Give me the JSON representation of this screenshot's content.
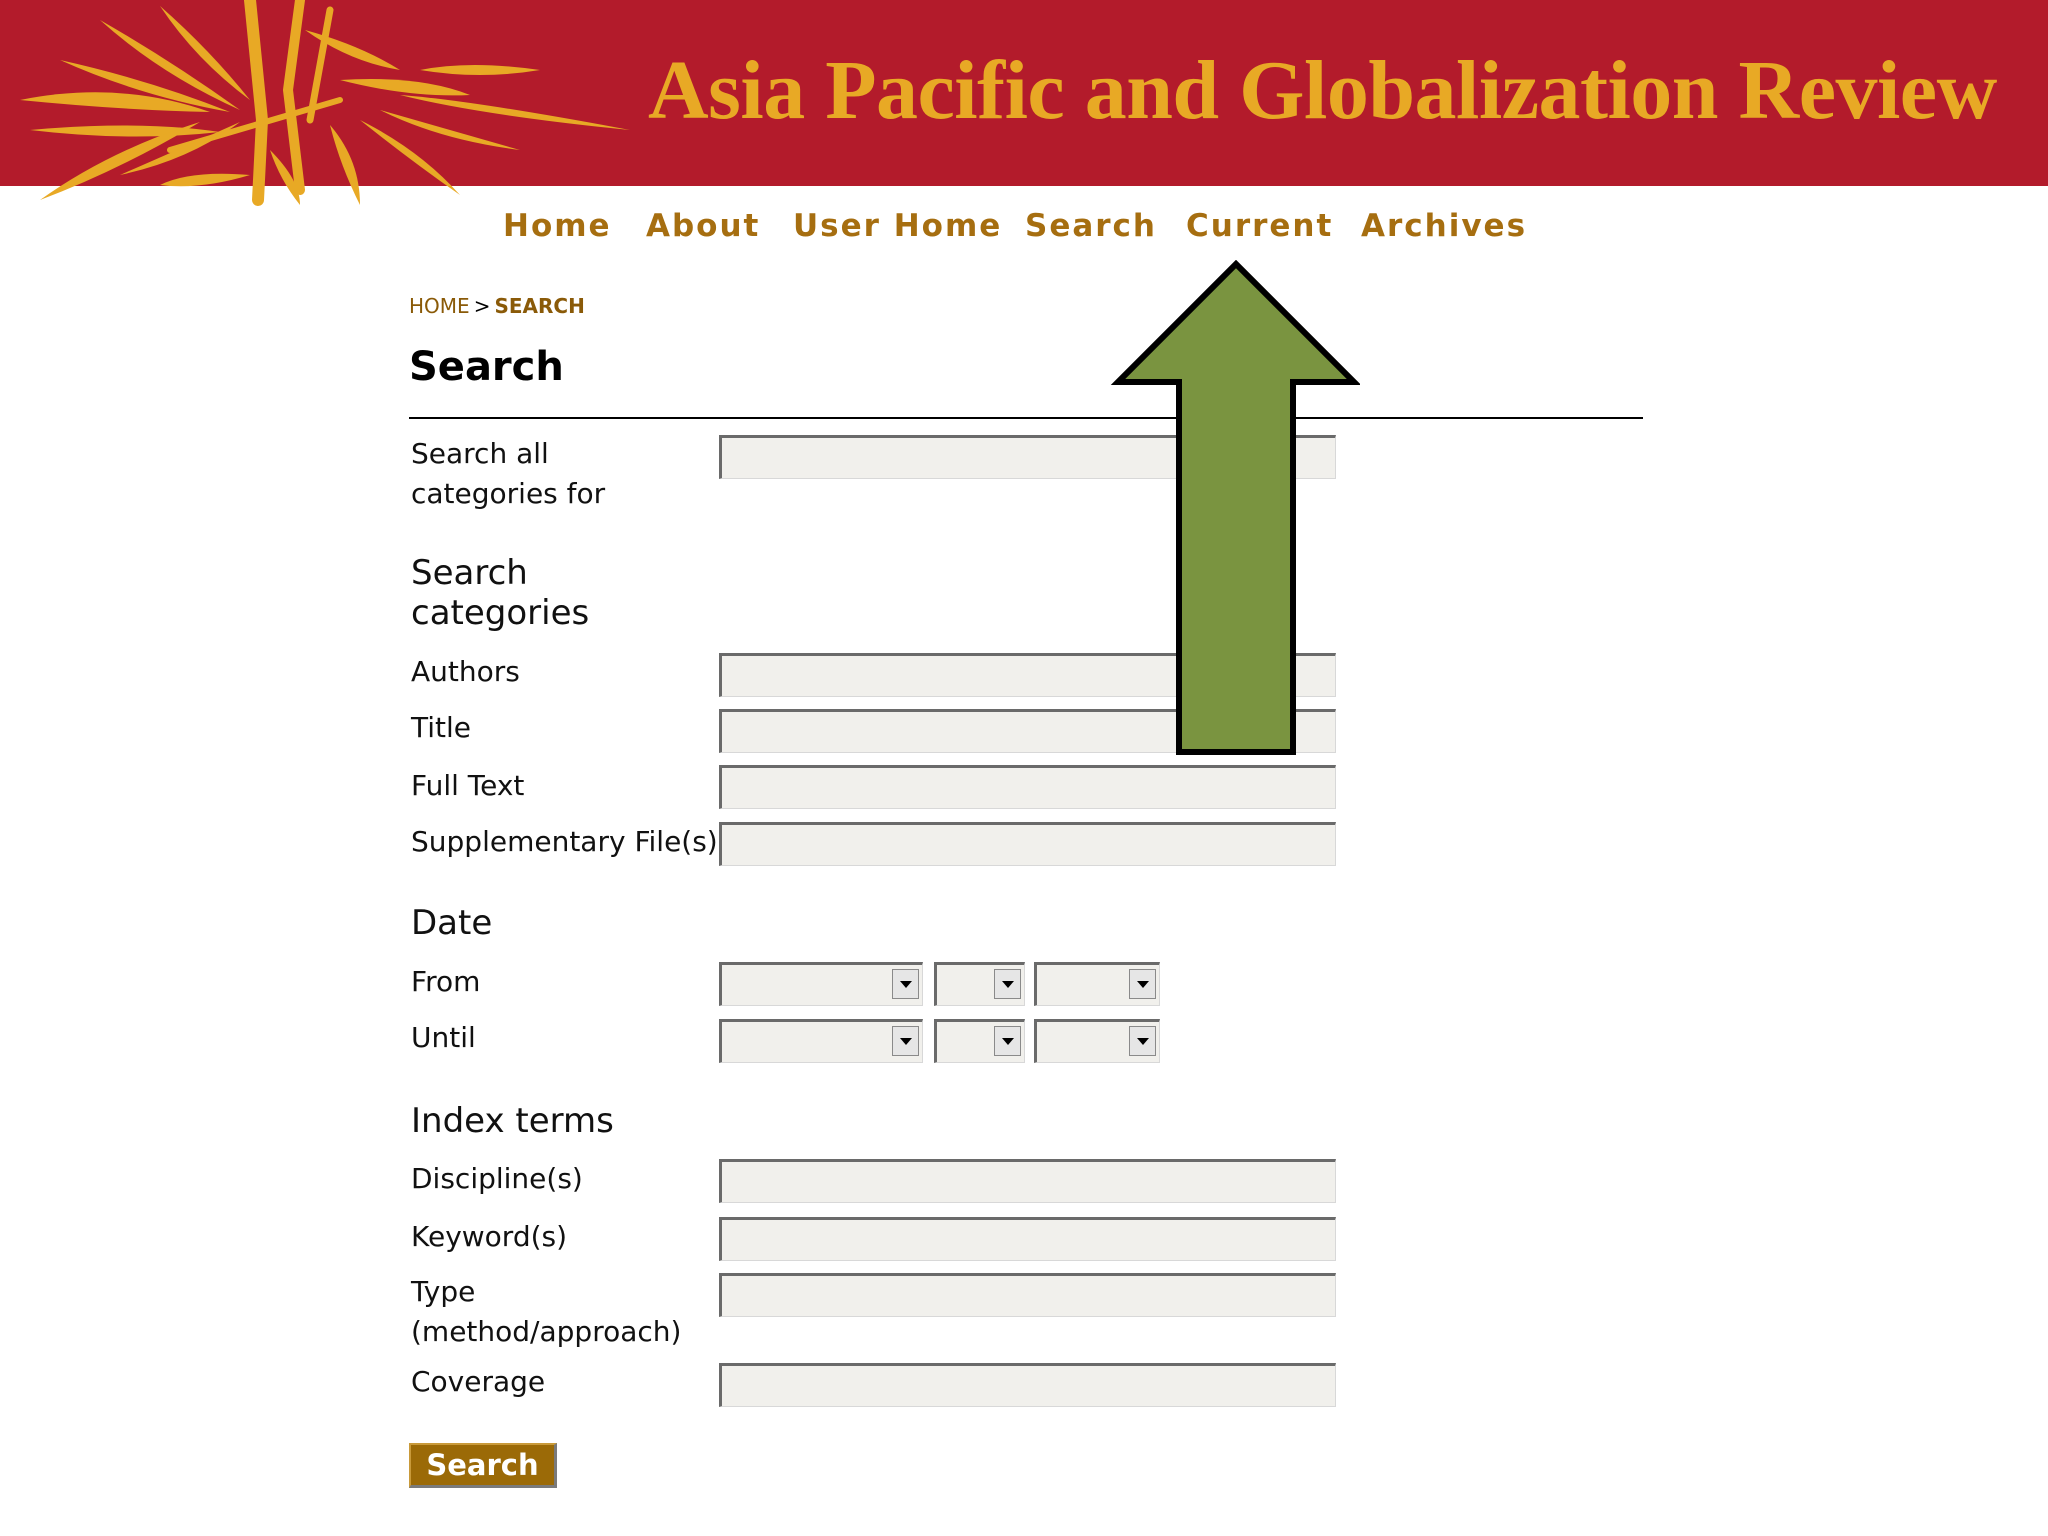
{
  "header": {
    "title": "Asia Pacific and Globalization Review"
  },
  "nav": {
    "items": [
      {
        "label": "Home"
      },
      {
        "label": "About"
      },
      {
        "label": "User Home"
      },
      {
        "label": "Search"
      },
      {
        "label": "Current"
      },
      {
        "label": "Archives"
      }
    ]
  },
  "breadcrumb": {
    "home": "HOME",
    "separator": ">",
    "current": "SEARCH"
  },
  "page": {
    "title": "Search"
  },
  "form": {
    "search_all_label": "Search all categories for",
    "categories_heading": "Search categories",
    "authors_label": "Authors",
    "title_label": "Title",
    "full_text_label": "Full Text",
    "supplementary_label": "Supplementary File(s)",
    "date_heading": "Date",
    "from_label": "From",
    "until_label": "Until",
    "index_terms_heading": "Index terms",
    "discipline_label": "Discipline(s)",
    "keywords_label": "Keyword(s)",
    "type_label": "Type (method/approach)",
    "coverage_label": "Coverage",
    "submit_label": "Search"
  },
  "colors": {
    "header_background": "#b31b2b",
    "title_gold": "#e8a925",
    "nav_link": "#a66e10",
    "button_background": "#9b6a07",
    "arrow_fill": "#7a9440"
  },
  "annotation": {
    "icon": "arrow-up-icon"
  }
}
